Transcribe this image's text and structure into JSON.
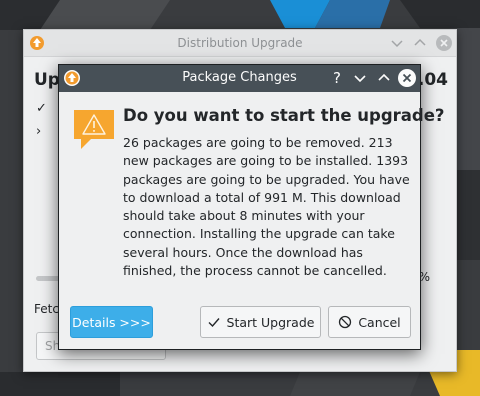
{
  "background_window": {
    "title": "Distribution Upgrade",
    "heading_left": "Upg",
    "heading_right": "0.04",
    "check_mark": "✓",
    "chevron": "›",
    "percent": "%",
    "fetch_label": "Fetc",
    "button_label": "Sh",
    "icons": [
      "upgrade-app-icon",
      "chevron-down-icon",
      "chevron-up-icon",
      "close-icon"
    ]
  },
  "dialog": {
    "title": "Package Changes",
    "help_label": "?",
    "heading": "Do you want to start the upgrade?",
    "body": "26 packages are going to be removed. 213 new packages are going to be installed. 1393 packages are going to be upgraded. You have to download a total of 991 M. This download should take about 8 minutes with your connection. Installing the upgrade can take several hours. Once the download has finished, the process cannot be cancelled.",
    "buttons": {
      "details": "Details >>>",
      "start": "Start Upgrade",
      "cancel": "Cancel"
    },
    "icons": [
      "upgrade-app-icon",
      "help-icon",
      "minimize-icon",
      "maximize-icon",
      "close-icon",
      "warning-icon",
      "checkmark-icon",
      "cancel-icon"
    ]
  },
  "colors": {
    "titlebar": "#475057",
    "accent": "#3daee9",
    "warning": "#f6a62f",
    "window_bg": "#eff0f1"
  }
}
